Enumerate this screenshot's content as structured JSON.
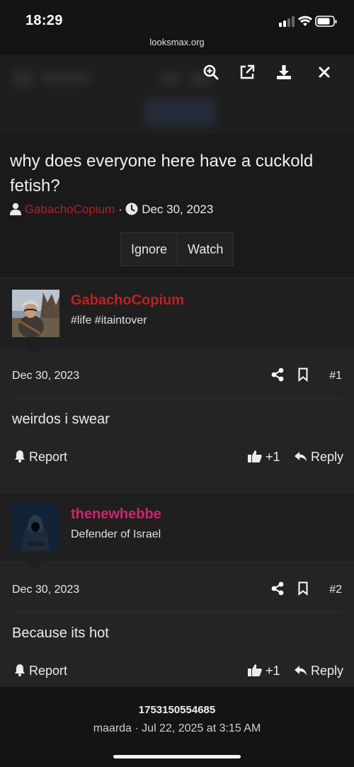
{
  "status_bar": {
    "time": "18:29"
  },
  "browser": {
    "url": "looksmax.org"
  },
  "viewer_toolbar": {
    "icons": [
      "zoom-in-icon",
      "open-external-icon",
      "download-icon",
      "close-icon"
    ]
  },
  "thread": {
    "title": "why does everyone here have a cuckold fetish?",
    "author": "GabachoCopium",
    "separator": "·",
    "date": "Dec 30, 2023",
    "buttons": {
      "ignore": "Ignore",
      "watch": "Watch"
    }
  },
  "posts": [
    {
      "username": "GabachoCopium",
      "username_color": "#c0201f",
      "user_title": "#life #itaintover",
      "date": "Dec 30, 2023",
      "number": "#1",
      "body": "weirdos i swear",
      "report_label": "Report",
      "like_count": "+1",
      "reply_label": "Reply"
    },
    {
      "username": "thenewhebbe",
      "username_color": "#d1246a",
      "user_title": "Defender of Israel",
      "date": "Dec 30, 2023",
      "number": "#2",
      "body": "Because its hot",
      "report_label": "Report",
      "like_count": "+1",
      "reply_label": "Reply"
    }
  ],
  "footer": {
    "id": "1753150554685",
    "meta": "maarda · Jul 22, 2025 at 3:15 AM"
  }
}
